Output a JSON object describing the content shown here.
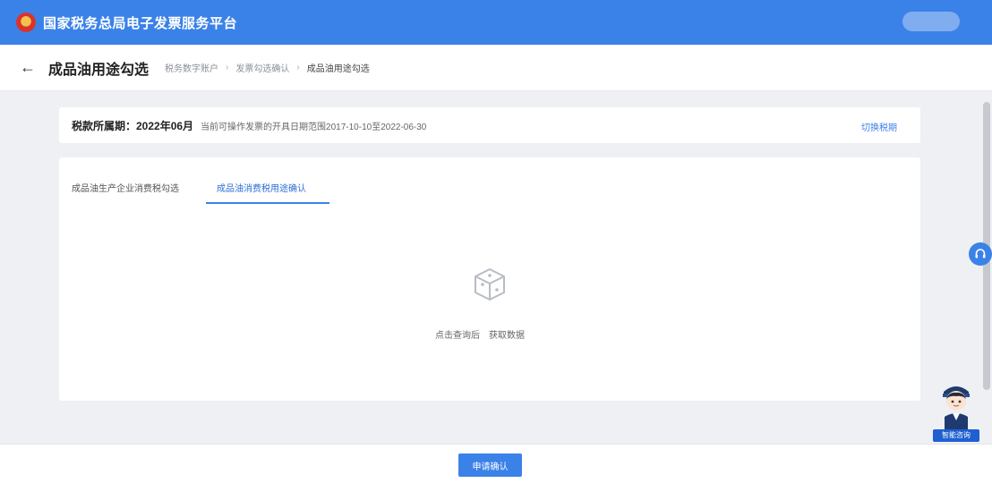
{
  "header": {
    "site_title": "国家税务总局电子发票服务平台",
    "emblem_icon": "tax-emblem-icon",
    "accent_color": "#3b82e8"
  },
  "page": {
    "back_icon": "arrow-left-icon",
    "title": "成品油用途勾选",
    "breadcrumb": [
      {
        "label": "税务数字账户"
      },
      {
        "label": "发票勾选确认"
      },
      {
        "label": "成品油用途勾选"
      }
    ]
  },
  "period": {
    "label": "税款所属期：2022年06月",
    "note": "当前可操作发票的开具日期范围2017-10-10至2022-06-30",
    "link": "切换税期"
  },
  "tabs": [
    {
      "label": "成品油生产企业消费税勾选"
    },
    {
      "label": "成品油消费税用途确认"
    }
  ],
  "empty_state": {
    "icon": "empty-box-icon",
    "text_a": "点击查询后",
    "text_b": "获取数据"
  },
  "footer": {
    "confirm_label": "申请确认"
  },
  "floating": {
    "support_icon": "headset-icon",
    "assistant_label": "智能咨询"
  }
}
